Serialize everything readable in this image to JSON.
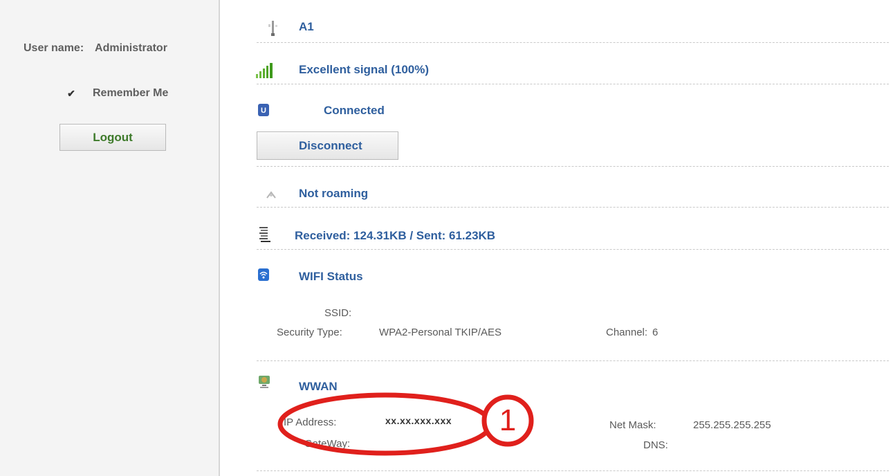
{
  "sidebar": {
    "user_label": "User name:",
    "user_value": "Administrator",
    "remember_label": "Remember Me",
    "logout_label": "Logout"
  },
  "status": {
    "device": "A1",
    "signal": "Excellent signal (100%)",
    "connection": "Connected",
    "disconnect_label": "Disconnect",
    "roaming": "Not roaming",
    "traffic": "Received:  124.31KB / Sent:  61.23KB"
  },
  "wifi": {
    "title": "WIFI Status",
    "ssid_label": "SSID:",
    "security_label": "Security Type:",
    "security_value": "WPA2-Personal TKIP/AES",
    "channel_label": "Channel:",
    "channel_value": "6"
  },
  "wwan": {
    "title": "WWAN",
    "ip_label": "IP Address:",
    "ip_value": "xx.xx.xxx.xxx",
    "gateway_label": "GateWay:",
    "netmask_label": "Net Mask:",
    "netmask_value": "255.255.255.255",
    "dns_label": "DNS:"
  },
  "callout": {
    "number": "1",
    "color": "#e0201c"
  },
  "colors": {
    "link_blue": "#2f5f9e",
    "logout_green": "#3d7a2a"
  }
}
